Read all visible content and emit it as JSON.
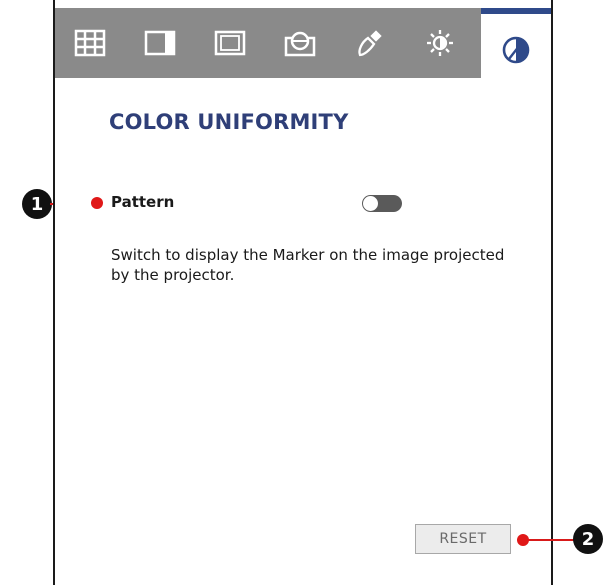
{
  "toolbar": {
    "tools": [
      {
        "name": "grid-icon"
      },
      {
        "name": "panel-split-icon"
      },
      {
        "name": "frame-icon"
      },
      {
        "name": "lens-icon"
      },
      {
        "name": "color-picker-icon"
      },
      {
        "name": "brightness-icon"
      },
      {
        "name": "color-uniformity-icon",
        "active": true
      }
    ],
    "active_accent": "#2f4a8a"
  },
  "panel": {
    "title": "COLOR UNIFORMITY",
    "pattern_label": "Pattern",
    "pattern_toggle_on": false,
    "description": "Switch to display the Marker on the image projected by the projector.",
    "reset_label": "RESET"
  },
  "callouts": {
    "one": "1",
    "two": "2",
    "line_color": "#d81a1a"
  }
}
